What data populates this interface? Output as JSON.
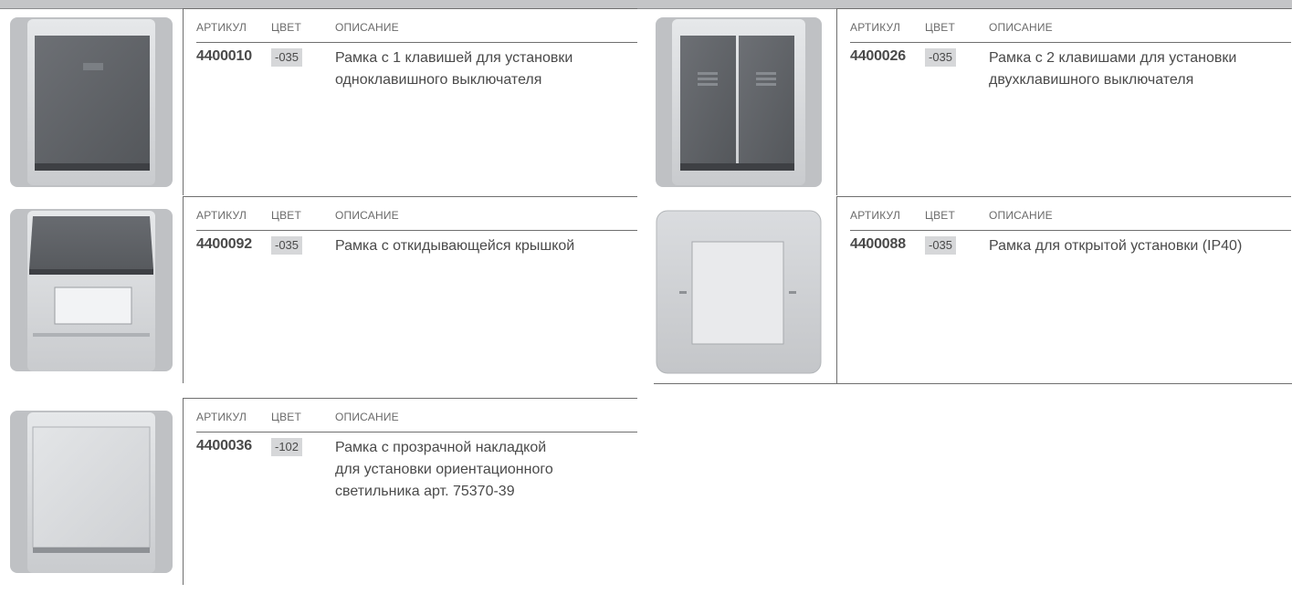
{
  "headers": {
    "article": "АРТИКУЛ",
    "color": "ЦВЕТ",
    "description": "ОПИСАНИЕ"
  },
  "products": [
    {
      "article": "4400010",
      "color": "-035",
      "description": [
        "Рамка с 1 клавишей для установки",
        "одноклавишного выключателя"
      ],
      "image": "frame-one-key-switch"
    },
    {
      "article": "4400026",
      "color": "-035",
      "description": [
        "Рамка с 2 клавишами для установки",
        "двухклавишного выключателя"
      ],
      "image": "frame-two-key-switch"
    },
    {
      "article": "4400092",
      "color": "-035",
      "description": [
        "Рамка с откидывающейся крышкой"
      ],
      "image": "frame-flip-cover"
    },
    {
      "article": "4400088",
      "color": "-035",
      "description": [
        "Рамка для открытой установки (IP40)"
      ],
      "image": "frame-surface-mount"
    },
    {
      "article": "4400036",
      "color": "-102",
      "description": [
        "Рамка с прозрачной накладкой",
        "для установки ориентационного",
        "светильника арт. 75370-39"
      ],
      "image": "frame-transparent-cover"
    }
  ],
  "colors": {
    "swatch": "#d6d7d9",
    "rule": "#6f6f6f",
    "top_bar": "#c4c5c7"
  }
}
